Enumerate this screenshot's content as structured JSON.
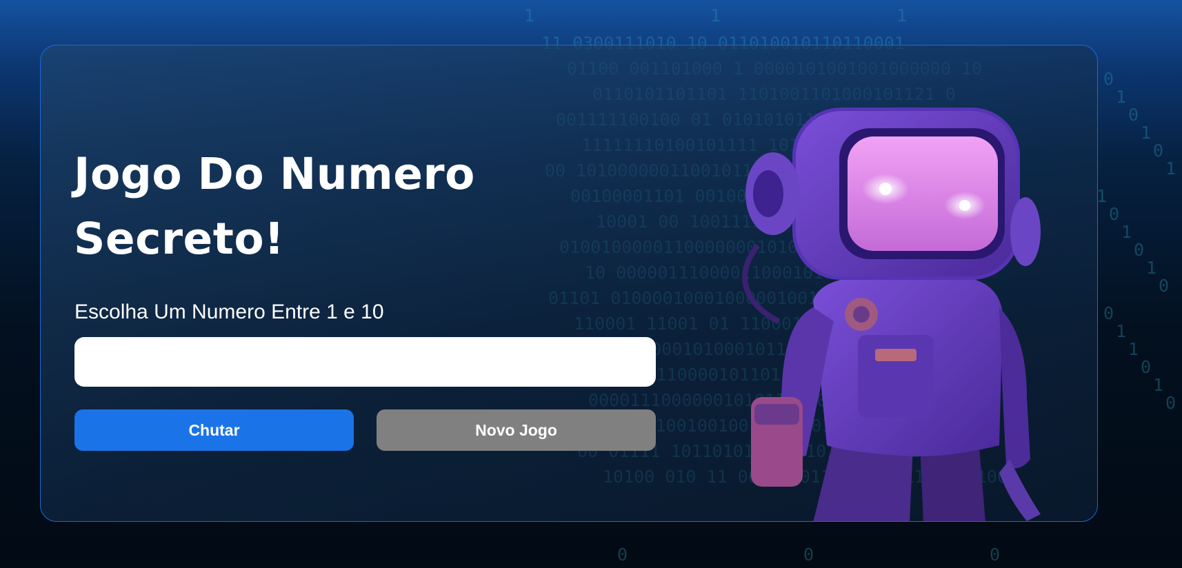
{
  "game": {
    "title": "Jogo Do Numero Secreto!",
    "prompt": "Escolha Um Numero Entre 1 e 10",
    "input_value": "",
    "input_placeholder": ""
  },
  "buttons": {
    "guess_label": "Chutar",
    "new_game_label": "Novo Jogo"
  },
  "background": {
    "binary_rows": [
      "11 0300111010 10 011010010110110001",
      "01100 001101000 1 0000101001001000000 10",
      "0110101101101 1101001101000101121 0",
      "001111100100 01 0101010111010101000010",
      "11111110100101111 1011000010001011 0 0",
      "00 1010000001100101101101000011 001011",
      "00100001101 00100000110100001 1000011 10",
      "10001 00 1001111010010100000011101",
      "010010000011000000010101011000010100011",
      "10 0000011100001100010111011110000",
      "01101 010000100010000010011111 01000",
      "110001 11001 01 1100010001101000110",
      "1011100010100010110110011100 1010",
      "11010001111000010110110111100010001 0",
      "000011100000010101101101110100011 0",
      "00111000011001001001010000100",
      "00 01111 101101010101110110011 11011",
      "10100 010 11 00110001111001011101 01100"
    ],
    "scattered_digits": [
      "0",
      "1",
      "0",
      "1",
      "0",
      "1",
      "1",
      "0",
      "1",
      "0",
      "1",
      "0",
      "0",
      "1",
      "1",
      "0",
      "1",
      "0",
      "1",
      "0",
      "1",
      "0",
      "1",
      "0"
    ]
  },
  "colors": {
    "primary_button": "#1a74e8",
    "secondary_button": "#808080",
    "card_border": "#1d6ad6",
    "binary_text": "#2d96af",
    "robot_body": "#6a40c8",
    "robot_visor": "#e186ec"
  },
  "illustration": {
    "name": "robot-astronaut"
  }
}
